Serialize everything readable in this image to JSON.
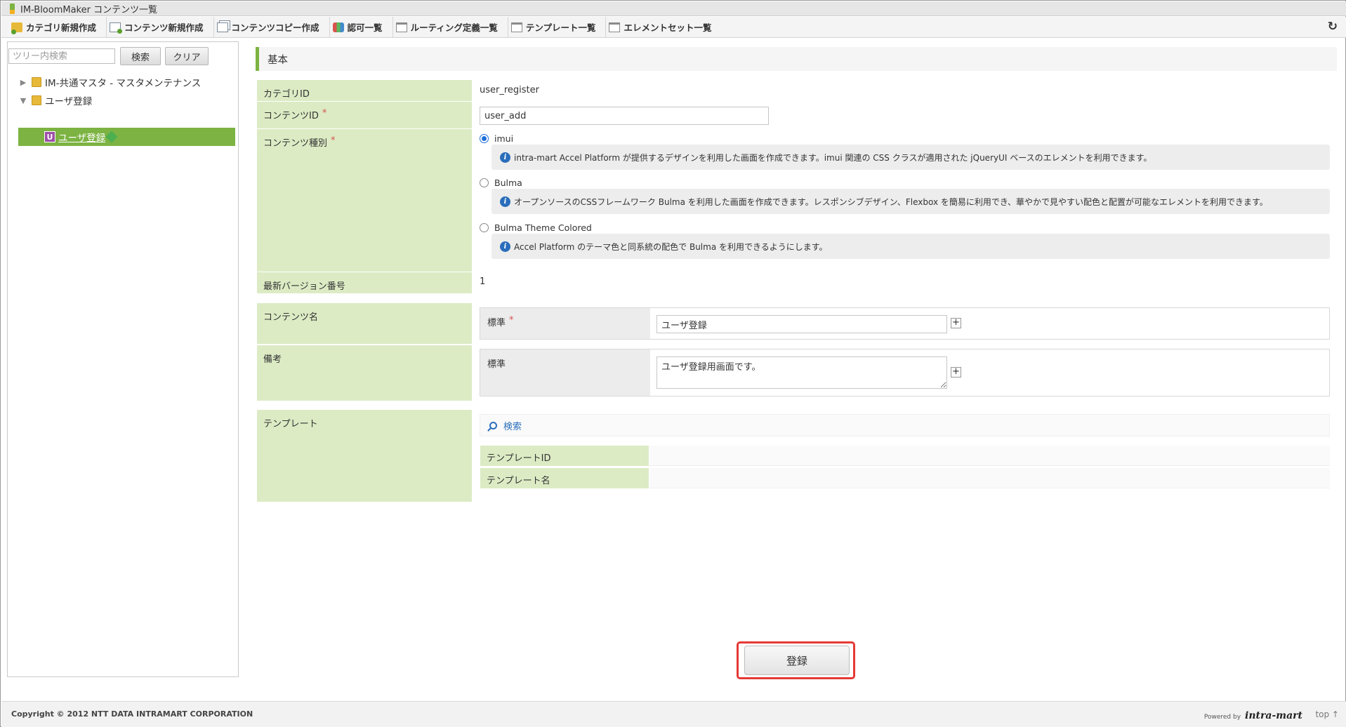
{
  "window": {
    "title": "IM-BloomMaker コンテンツ一覧"
  },
  "toolbar": {
    "items": [
      {
        "label": "カテゴリ新規作成",
        "icon": "folder-add-icon"
      },
      {
        "label": "コンテンツ新規作成",
        "icon": "page-add-icon"
      },
      {
        "label": "コンテンツコピー作成",
        "icon": "copy-icon"
      },
      {
        "label": "認可一覧",
        "icon": "authorization-icon"
      },
      {
        "label": "ルーティング定義一覧",
        "icon": "window-icon"
      },
      {
        "label": "テンプレート一覧",
        "icon": "window-icon"
      },
      {
        "label": "エレメントセット一覧",
        "icon": "window-icon"
      }
    ],
    "refresh_icon": "refresh-icon"
  },
  "tree": {
    "search_placeholder": "ツリー内検索",
    "search_button": "検索",
    "clear_button": "クリア",
    "nodes": [
      {
        "label": "IM-共通マスタ - マスタメンテナンス",
        "expanded": false
      },
      {
        "label": "ユーザ登録",
        "expanded": true
      }
    ],
    "selected": {
      "badge": "U",
      "label": "ユーザ登録"
    }
  },
  "form": {
    "section_title": "基本",
    "category_id": {
      "label": "カテゴリID",
      "value": "user_register"
    },
    "content_id": {
      "label": "コンテンツID",
      "required_mark": "*",
      "value": "user_add"
    },
    "content_type": {
      "label": "コンテンツ種別",
      "required_mark": "*",
      "options": [
        {
          "label": "imui",
          "checked": true,
          "info": "intra-mart Accel Platform が提供するデザインを利用した画面を作成できます。imui 関連の CSS クラスが適用された jQueryUI ベースのエレメントを利用できます。"
        },
        {
          "label": "Bulma",
          "checked": false,
          "info": "オープンソースのCSSフレームワーク Bulma を利用した画面を作成できます。レスポンシブデザイン、Flexbox を簡易に利用でき、華やかで見やすい配色と配置が可能なエレメントを利用できます。"
        },
        {
          "label": "Bulma Theme Colored",
          "checked": false,
          "info": "Accel Platform のテーマ色と同系統の配色で Bulma を利用できるようにします。"
        }
      ]
    },
    "latest_version": {
      "label": "最新バージョン番号",
      "value": "1"
    },
    "content_name": {
      "label": "コンテンツ名",
      "sub_label": "標準",
      "required_mark": "*",
      "value": "ユーザ登録"
    },
    "remarks": {
      "label": "備考",
      "sub_label": "標準",
      "value": "ユーザ登録用画面です。"
    },
    "template": {
      "label": "テンプレート",
      "search_link": "検索",
      "id_label": "テンプレートID",
      "name_label": "テンプレート名"
    },
    "submit_button": "登録"
  },
  "footer": {
    "copyright": "Copyright © 2012 NTT DATA INTRAMART CORPORATION",
    "powered_by": "Powered by",
    "brand": "intra-mart",
    "top_link": "top ↑"
  },
  "colors": {
    "accent_green": "#7cb342",
    "label_green": "#dcebc4",
    "link_blue": "#2a6ebb",
    "highlight_red": "#e53935"
  }
}
